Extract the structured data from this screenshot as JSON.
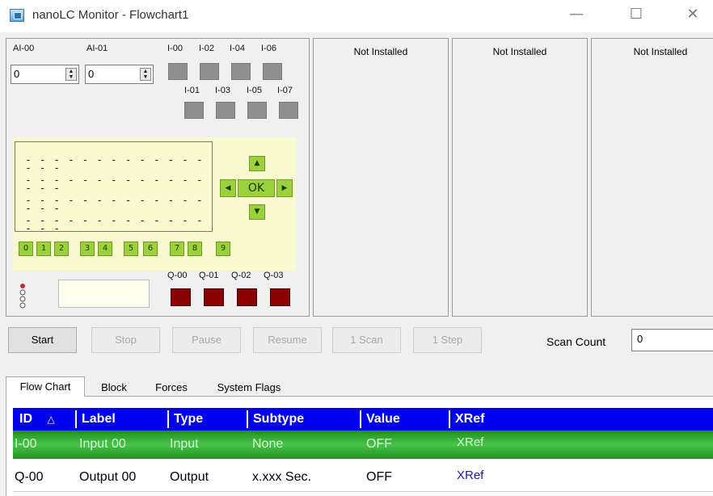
{
  "window": {
    "title": "nanoLC Monitor - Flowchart1",
    "minimize": "—",
    "maximize": "☐",
    "close": "✕"
  },
  "analog": [
    {
      "label": "AI-00",
      "value": "0"
    },
    {
      "label": "AI-01",
      "value": "0"
    }
  ],
  "inputs_top": [
    "I-00",
    "I-02",
    "I-04",
    "I-06"
  ],
  "inputs_bottom": [
    "I-01",
    "I-03",
    "I-05",
    "I-07"
  ],
  "nav": {
    "up": "▲",
    "left": "◀",
    "ok": "OK",
    "right": "▶",
    "down": "▼"
  },
  "number_keys": [
    "0",
    "1",
    "2",
    "3",
    "4",
    "5",
    "6",
    "7",
    "8",
    "9"
  ],
  "outputs": [
    "Q-00",
    "Q-01",
    "Q-02",
    "Q-03"
  ],
  "expansion": [
    "Not Installed",
    "Not Installed",
    "Not Installed"
  ],
  "buttons": {
    "start": "Start",
    "stop": "Stop",
    "pause": "Pause",
    "resume": "Resume",
    "scan1": "1 Scan",
    "step1": "1 Step"
  },
  "scan_count": {
    "label": "Scan Count",
    "value": "0"
  },
  "tabs": [
    "Flow Chart",
    "Block",
    "Forces",
    "System Flags"
  ],
  "grid": {
    "columns": [
      "ID",
      "Label",
      "Type",
      "Subtype",
      "Value",
      "XRef"
    ],
    "sort_indicator": "△",
    "rows": [
      {
        "id": "I-00",
        "label": "Input 00",
        "type": "Input",
        "subtype": "None",
        "value": "OFF",
        "xref": "XRef"
      },
      {
        "id": "Q-00",
        "label": "Output 00",
        "type": "Output",
        "subtype": "x.xxx Sec.",
        "value": "OFF",
        "xref": "XRef"
      }
    ]
  },
  "colors": {
    "header": "#0000f0",
    "selected_row": "#3fb83f",
    "lcd": "#fafad0",
    "key_green": "#9bd13a",
    "output_off": "#8b0000"
  }
}
